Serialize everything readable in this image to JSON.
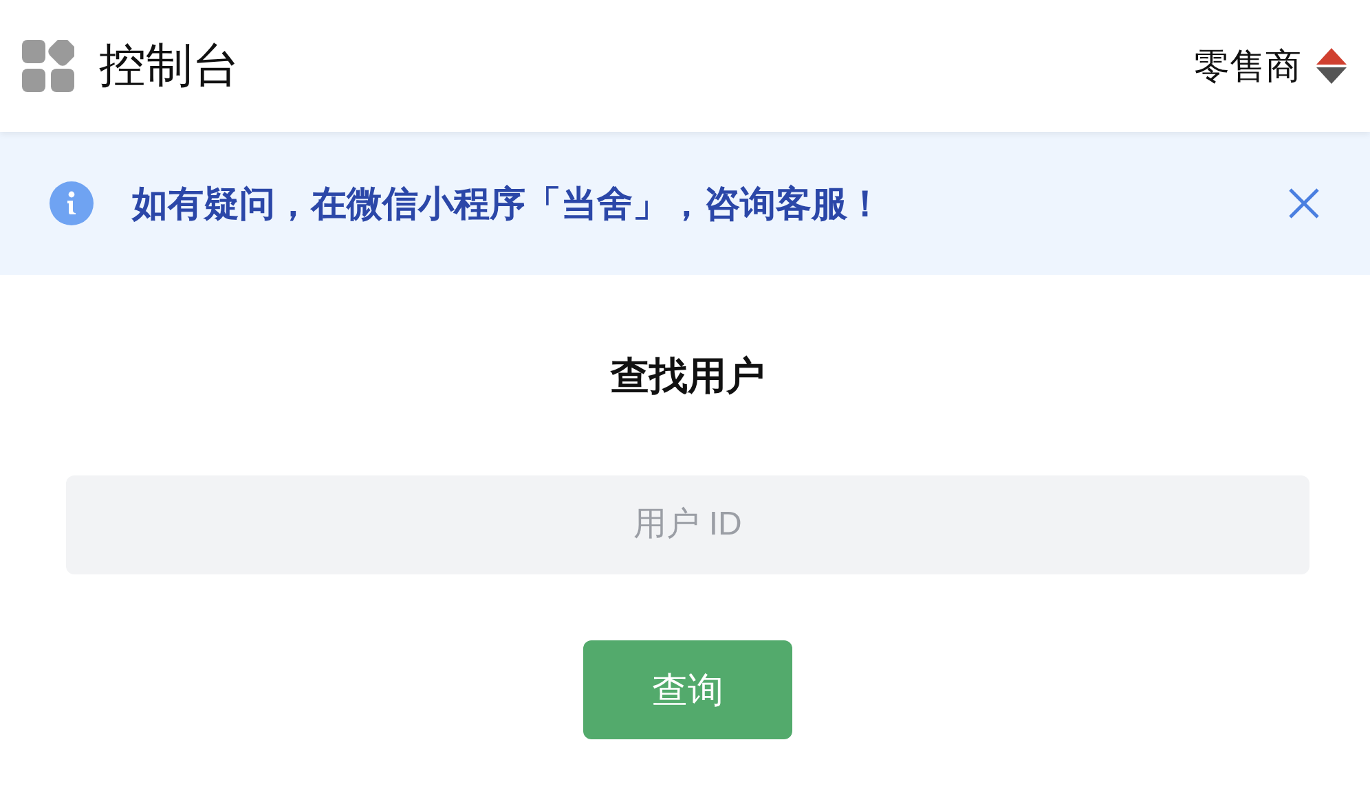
{
  "header": {
    "title": "控制台",
    "role": "零售商"
  },
  "notice": {
    "text": "如有疑问，在微信小程序「当舍」，咨询客服！"
  },
  "search": {
    "title": "查找用户",
    "placeholder": "用户 ID",
    "button": "查询"
  }
}
